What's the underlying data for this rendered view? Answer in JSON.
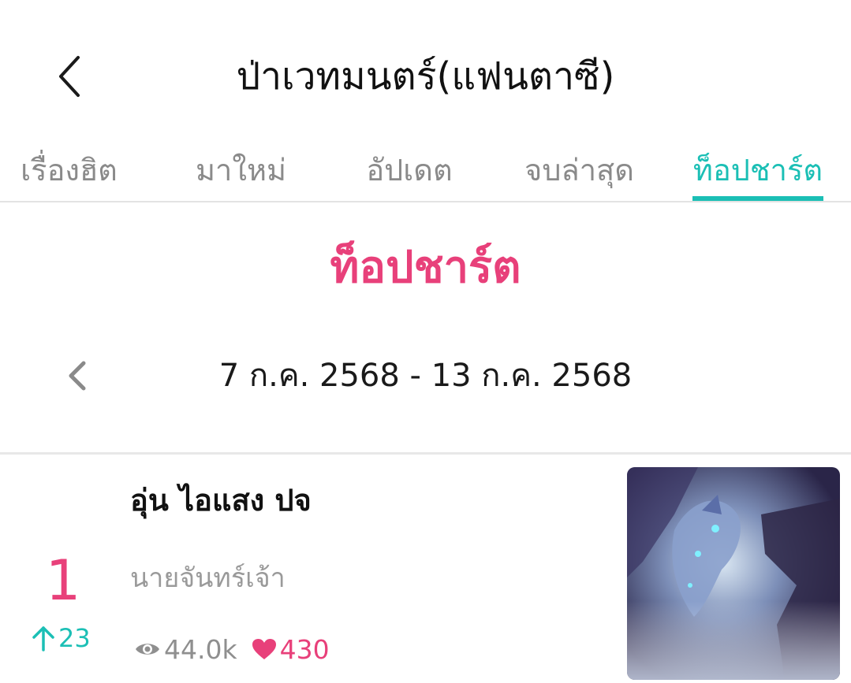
{
  "header": {
    "back_icon": "chevron-left-icon",
    "title": "ป่าเวทมนตร์(แฟนตาซี)"
  },
  "tabs": [
    {
      "label": "เรื่องฮิต",
      "active": false
    },
    {
      "label": "มาใหม่",
      "active": false
    },
    {
      "label": "อัปเดต",
      "active": false
    },
    {
      "label": "จบล่าสุด",
      "active": false
    },
    {
      "label": "ท็อปชาร์ต",
      "active": true
    }
  ],
  "chart": {
    "heading": "ท็อปชาร์ต",
    "week_range": "7 ก.ค. 2568 - 13 ก.ค. 2568",
    "prev_icon": "chevron-left-icon"
  },
  "entries": [
    {
      "rank": "1",
      "change": "23",
      "change_direction": "up",
      "title": "อุ่น ไอแสง ปจ",
      "author": "นายจันทร์เจ้า",
      "views": "44.0k",
      "likes": "430",
      "cover_icon": "dragon-cover-art"
    }
  ],
  "colors": {
    "accent_teal": "#1bbfb5",
    "accent_pink": "#e8407a",
    "muted_text": "#8a8a8a"
  }
}
